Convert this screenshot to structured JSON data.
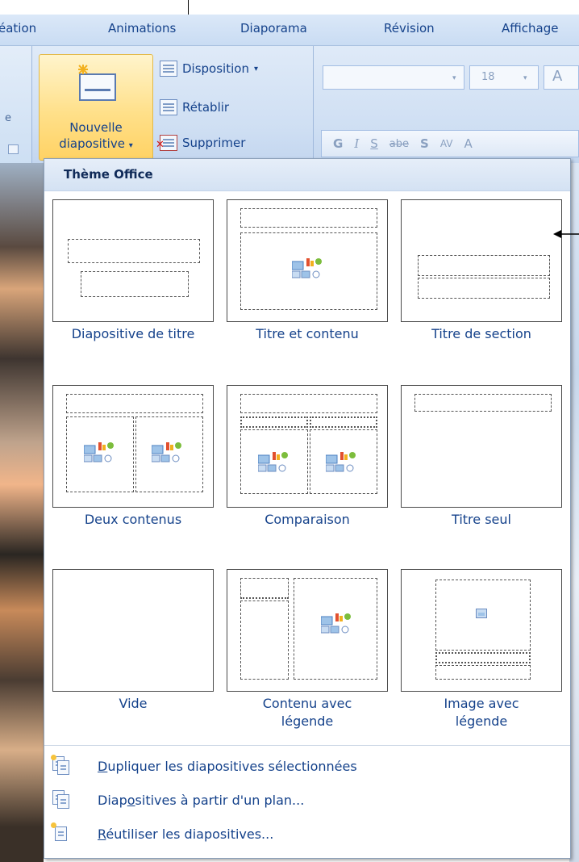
{
  "ribbon_tabs": [
    "éation",
    "Animations",
    "Diaporama",
    "Révision",
    "Affichage"
  ],
  "ribbon": {
    "new_slide_line1": "Nouvelle",
    "new_slide_line2": "diapositive",
    "new_slide_arrow": "▾",
    "disposition": "Disposition",
    "disposition_arrow": "▾",
    "retablir": "Rétablir",
    "supprimer": "Supprimer",
    "left_group_char": "e",
    "font_size": "18",
    "grow_font": "A",
    "format_buttons": [
      "G",
      "I",
      "S",
      "abe",
      "S",
      "AV",
      "A"
    ]
  },
  "gallery": {
    "title": "Thème Office",
    "layouts": [
      {
        "label": "Diapositive de titre",
        "kind": "title-slide"
      },
      {
        "label": "Titre et contenu",
        "kind": "title-content"
      },
      {
        "label": "Titre de section",
        "kind": "section-header"
      },
      {
        "label": "Deux contenus",
        "kind": "two-content"
      },
      {
        "label": "Comparaison",
        "kind": "comparison"
      },
      {
        "label": "Titre seul",
        "kind": "title-only"
      },
      {
        "label": "Vide",
        "kind": "blank"
      },
      {
        "label": "Contenu avec légende",
        "label_line1": "Contenu avec",
        "label_line2": "légende",
        "kind": "content-caption"
      },
      {
        "label": "Image avec légende",
        "label_line1": "Image avec",
        "label_line2": "légende",
        "kind": "picture-caption"
      }
    ],
    "menu": [
      {
        "underline": "D",
        "rest": "upliquer les diapositives sélectionnées",
        "icon": "duplicate-slides-icon"
      },
      {
        "before": "Diap",
        "underline": "o",
        "rest": "sitives à partir d'un plan...",
        "icon": "slides-from-outline-icon"
      },
      {
        "underline": "R",
        "rest": "éutiliser les diapositives...",
        "icon": "reuse-slides-icon"
      }
    ]
  }
}
